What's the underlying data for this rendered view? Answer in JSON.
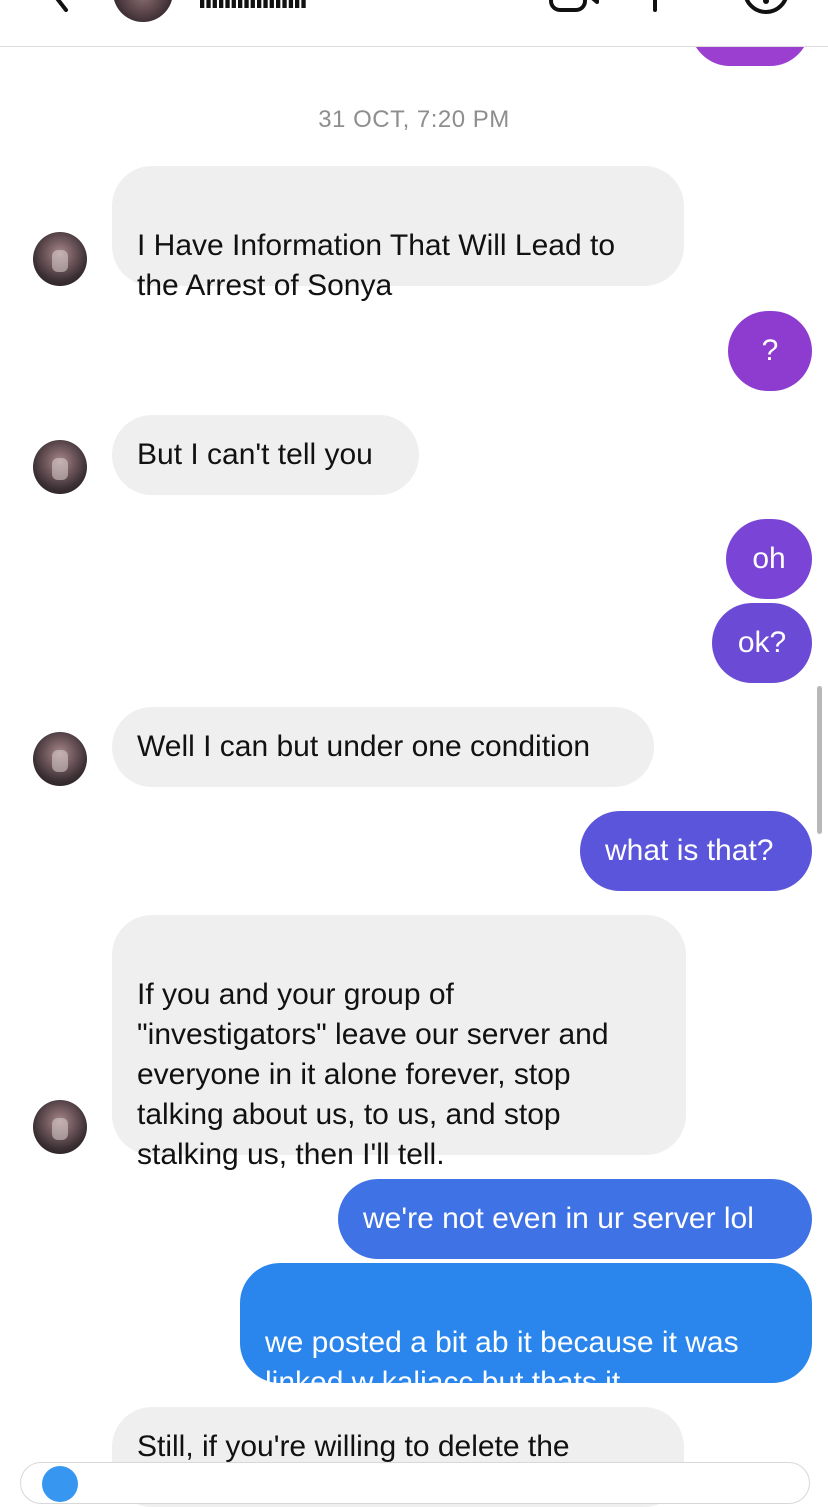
{
  "header": {
    "contact_name": "IIIIIIIIIIIIIIIII"
  },
  "timestamp": "31 OCT, 7:20 PM",
  "messages": [
    {
      "id": "m1",
      "side": "in",
      "text": "I Have Information That Will Lead to\nthe Arrest of Sonya"
    },
    {
      "id": "m2",
      "side": "out",
      "text": "?",
      "color": "#8e3ccf"
    },
    {
      "id": "m3",
      "side": "in",
      "text": "But I can't tell you"
    },
    {
      "id": "m4",
      "side": "out",
      "text": "oh",
      "color": "#7a45d6"
    },
    {
      "id": "m5",
      "side": "out",
      "text": "ok?",
      "color": "#6b4ad6"
    },
    {
      "id": "m6",
      "side": "in",
      "text": "Well I can but under one condition"
    },
    {
      "id": "m7",
      "side": "out",
      "text": "what is that?",
      "color": "#5a55db"
    },
    {
      "id": "m8",
      "side": "in",
      "text": "If you and your group of\n\"investigators\" leave our server and\neveryone in it alone forever, stop\ntalking about us, to us, and stop\nstalking us, then I'll tell."
    },
    {
      "id": "m9",
      "side": "out",
      "text": "we're not even in ur server lol",
      "color": "#3f72e4"
    },
    {
      "id": "m10",
      "side": "out",
      "text": "we posted a bit ab it because it was\nlinked w kaliacc but thats it",
      "color": "#2a86ec"
    },
    {
      "id": "m11",
      "side": "in",
      "text": "Still, if you're willing to delete the"
    }
  ],
  "colors": {
    "incoming_bubble": "#efefef",
    "top_bubble": "#9a3fd0",
    "timestamp": "#8e8e8e"
  },
  "icons": {
    "back": "chevron-left-icon",
    "video": "video-camera-icon",
    "call": "phone-icon",
    "info": "info-icon"
  }
}
